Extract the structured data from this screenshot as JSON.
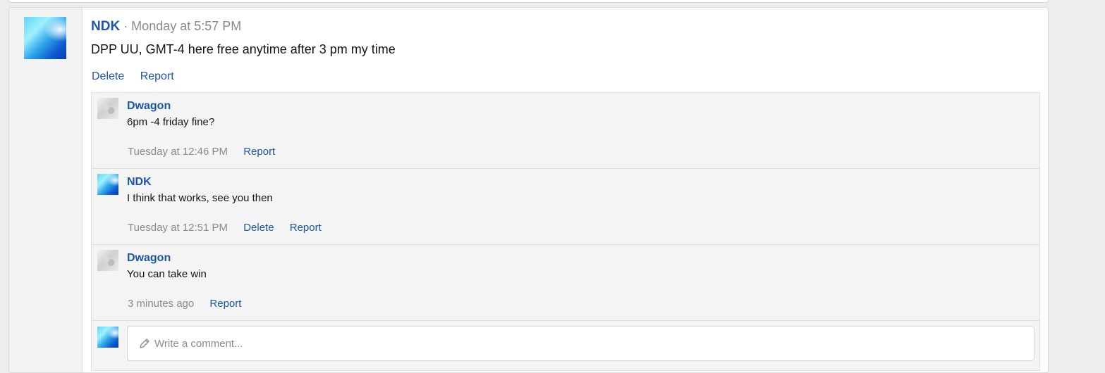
{
  "post": {
    "author": "NDK",
    "meta": "· Monday at 5:57 PM",
    "text": "DPP UU, GMT-4 here free anytime after 3 pm my time",
    "actions": {
      "delete": "Delete",
      "report": "Report"
    }
  },
  "comments": [
    {
      "author": "Dwagon",
      "text": "6pm -4 friday fine?",
      "time": "Tuesday at 12:46 PM",
      "report": "Report",
      "avatar": "dwagon-avatar"
    },
    {
      "author": "NDK",
      "text": "I think that works, see you then",
      "time": "Tuesday at 12:51 PM",
      "delete": "Delete",
      "report": "Report",
      "avatar": "ndk-avatar"
    },
    {
      "author": "Dwagon",
      "text": "You can take win",
      "time": "3 minutes ago",
      "report": "Report",
      "avatar": "dwagon-avatar"
    }
  ],
  "composer": {
    "placeholder": "Write a comment...",
    "icon": "pencil-icon"
  },
  "colors": {
    "link": "#1d56a8",
    "muted": "#8a8a8a",
    "comment_bg": "#f4f4f4"
  }
}
